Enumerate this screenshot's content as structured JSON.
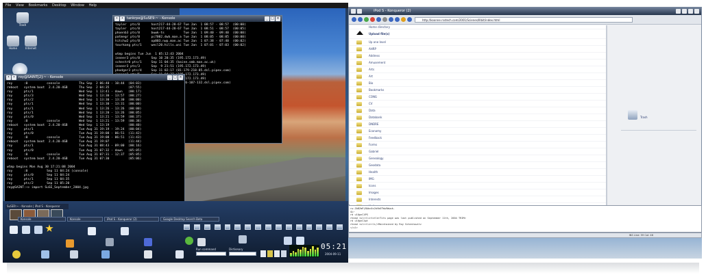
{
  "menubar": {
    "items": [
      "File",
      "View",
      "Bookmarks",
      "Desktop",
      "Window",
      "Help"
    ]
  },
  "desktop_icons": [
    {
      "label": "Trash"
    },
    {
      "label": "Home"
    },
    {
      "label": "Internet"
    }
  ],
  "term_top": {
    "title": "tankrpe@SuSE9:~ - Konsole",
    "lines": [
      "tayler  pts/0      host217-44-28-67 Tue Jan  1 08:57 - 08:57  (00:00)",
      "tayler  pts/0      host217-44-28-67 Tue Jan  1 08:51 - 08:57  (00:05)",
      "phoenb3 pts/0      bwwk-ts          Tue Jan  1 09:40 - 09:40  (00:00)",
      "patmegr pts/0      pc7002.dwb.man.a Tue Jan  1 08:05 - 08:05  (00:00)",
      "hitchw2 pts/0      op003.nwp.man.ac Tue Jan  1 07:38 - 07:40  (00:02)",
      "tourkang pts/1     wecl20.hills.uni Tue Jan  1 07:01 - 07:03  (00:02)",
      "",
      "wtmp begins Tue Jun  1 05:12:43 2004",
      "inneer3 pts/0      Sep 10 20:35 (195.172.173.49)",
      "schestr0 pts/1     Sep 11 04:35 (baine.smb.man.ac.uk)",
      "inneer3 pts/3      Sep  9 21:51 (195.172.173.49)",
      "phodger3 pts/4     Sep 11 02:17 (81-179-218-85.dsl.pipex.com)",
      "inneer3 pts/5      Sep 11 04:27 (195.172.173.49)",
      "inneer3 pts/2      Sep 11 04:24 (195.172.173.49)",
      "phodger3 pts/4     Sep 11 02:31 (81-86-107-132.dsl.pipex.com)"
    ]
  },
  "term_bot": {
    "title": "roy@SAINT[2]:~ - Konsole",
    "lines": [
      "roy      :0          console          Thu Sep  2 06:40 - 10:44  (04:03)",
      "reboot   system boot  2.4.20-4GB      Thu Sep  2 04:35          (07:55)",
      "roy      pts/1                        Wed Sep  1 13:41 - down   (00:17)",
      "roy      pts/3                        Wed Sep  1 13:30 - 13:57  (00:27)",
      "roy      pts/2                        Wed Sep  1 13:30 - 13:30  (00:00)",
      "roy      pts/1                        Wed Sep  1 13:30 - 13:31  (00:00)",
      "roy      pts/1                        Wed Sep  1 13:26 - 13:26  (00:00)",
      "roy      pts/1                        Wed Sep  1 13:20 - 13:26  (00:05)",
      "roy      pts/0                        Wed Sep  1 13:21 - 13:59  (00:37)",
      "roy      :0          console          Wed Sep  1 13:21 - 13:59  (00:38)",
      "reboot   system boot  2.4.20-4GB      Wed Sep  1 13:19          (00:40)",
      "roy      pts/1                        Tue Aug 31 19:19 - 19:24  (00:04)",
      "roy      pts/0                        Tue Aug 31 19:08 - 06:51  (11:42)",
      "roy      :0          console          Tue Aug 31 19:08 - 06:51  (11:43)",
      "reboot   system boot  2.4.20-4GB      Tue Aug 31 19:07          (11:44)",
      "roy      pts/1                        Tue Aug 31 08:43 - 09:00  (00:16)",
      "roy      pts/0                        Tue Aug 31 07:32 - down   (05:05)",
      "roy      :0          console          Tue Aug 31 07:31 - 12:37  (05:05)",
      "reboot   system boot  2.4.20-4GB      Tue Aug 31 07:30          (05:06)",
      "",
      "wtmp begins Mon Aug 30 17:21:08 2004",
      "roy      :0          Sep 11 04:24 (console)",
      "roy      pts/0       Sep 11 04:24",
      "roy      pts/1       Sep 11 04:35",
      "roy      pts/2       Sep 11 05:20",
      "roy@SAINT:~> import SuSE_September_2004.jpg"
    ]
  },
  "panel": {
    "taskbar": [
      "Konsole",
      "Konsole",
      "iPod S - Konqueror (2)",
      "Google Desktop Search Beta"
    ],
    "small_tasks": [
      "SuSE9:~ - Konsole",
      "iPod S - Konqueror"
    ],
    "run_command_label": "Run command",
    "dictionary_label": "Dictionary",
    "clock": "05:21",
    "date": "2004-09-11",
    "accent": "#2a3a55"
  },
  "konq": {
    "title": "iPod S - Konqueror (2)",
    "location": "http://koonne.rsstech.com/2001/Scienes/Illbit/index.html",
    "header_item": "Home directory",
    "upload_label": "Upload file(s)",
    "folders": [
      "Up one level",
      "AHRP",
      "Address",
      "Amusement",
      "Arts",
      "Art",
      "Bio",
      "Bookmarks",
      "CONG",
      "CV",
      "Data",
      "Databank",
      "DNDRE",
      "Economy",
      "Feedback",
      "Forms",
      "Gabriel",
      "Genealogy",
      "Geodata",
      "Health",
      "IMG",
      "Icons",
      "Images",
      "Interests",
      "Mail",
      "Models",
      "Music",
      "Nodes",
      "POP",
      "Projects"
    ],
    "sidebar_trash": "Trash"
  },
  "lowtext": {
    "lines": [
      "rw-ZbBZmPjBAbc0x2bVb0TWw9Wwwk-",
      "$%~",
      "rd ul@pnC4PS",
      "rhead <ul><li>title>Tits page was last published on September 11th, 2004 TRIM>",
      "rd ul@pnC4pt",
      "rhead <ul><li><li/>Maintained by Roy Schestowitz",
      "</ul>"
    ]
  },
  "lowstat": {
    "text": "INS   Line: 59 Col: 46"
  }
}
